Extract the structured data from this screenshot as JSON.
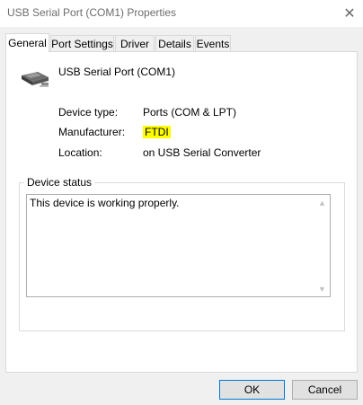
{
  "window": {
    "title": "USB Serial Port (COM1) Properties"
  },
  "tabs": [
    {
      "label": "General",
      "active": true
    },
    {
      "label": "Port Settings",
      "active": false
    },
    {
      "label": "Driver",
      "active": false
    },
    {
      "label": "Details",
      "active": false
    },
    {
      "label": "Events",
      "active": false
    }
  ],
  "device": {
    "name": "USB Serial Port (COM1)",
    "icon": "usb-connector-icon"
  },
  "properties": [
    {
      "label": "Device type:",
      "value": "Ports (COM & LPT)"
    },
    {
      "label": "Manufacturer:",
      "value": "FTDI"
    },
    {
      "label": "Location:",
      "value": "on USB Serial Converter"
    }
  ],
  "status_group": {
    "label": "Device status",
    "text": "This device is working properly."
  },
  "buttons": {
    "ok": "OK",
    "cancel": "Cancel"
  },
  "colors": {
    "highlight": "#ffff00",
    "default_button_border": "#0078d7"
  }
}
